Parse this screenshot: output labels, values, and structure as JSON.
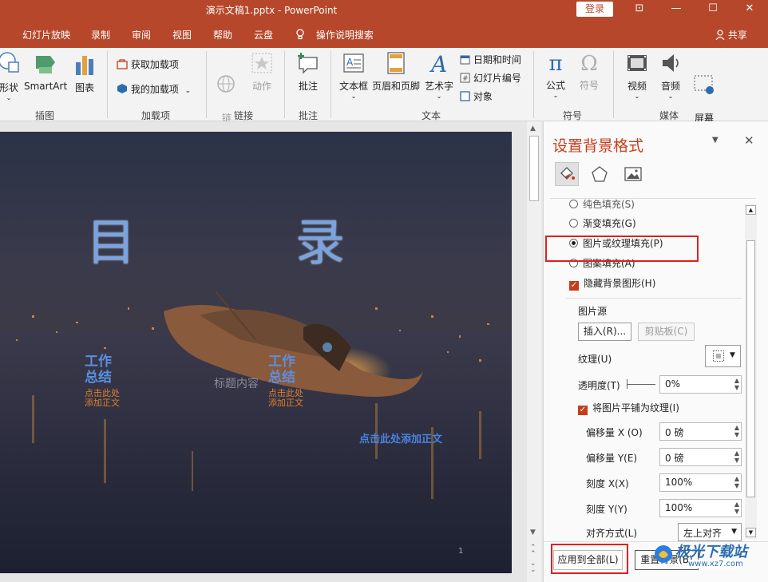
{
  "window": {
    "title": "演示文稿1.pptx  -  PowerPoint",
    "login": "登录",
    "controls": {
      "restore_ribbon": "⊡",
      "minimize": "—",
      "maximize": "☐",
      "close": "✕"
    }
  },
  "tabs": [
    "幻灯片放映",
    "录制",
    "审阅",
    "视图",
    "帮助",
    "云盘",
    "操作说明搜索"
  ],
  "share_label": "共享",
  "ribbon": {
    "shape_label": "形状",
    "smartart_label": "SmartArt",
    "chart_label": "图表",
    "get_addins_label": "获取加载项",
    "my_addins_label": "我的加载项",
    "link_label": "链\n接",
    "action_label": "动作",
    "comment_label": "批注",
    "textbox_label": "文本框",
    "header_footer_label": "页眉和页脚",
    "wordart_label": "艺术字",
    "datetime_label": "日期和时间",
    "slide_number_label": "幻灯片编号",
    "object_label": "对象",
    "equation_label": "公式",
    "symbol_label": "符号",
    "video_label": "视频",
    "audio_label": "音频",
    "screen_record_label": "屏幕\n录制",
    "groups": {
      "illustrations": "插图",
      "addins": "加载项",
      "links": "链接",
      "comments": "批注",
      "text": "文本",
      "symbols": "符号",
      "media": "媒体"
    }
  },
  "slide": {
    "title_left": "目",
    "title_right": "录",
    "item1_title": "工作\n总结",
    "item1_sub": "点击此处\n添加正文",
    "item2_title": "工作\n总结",
    "item2_sub": "点击此处\n添加正文",
    "center_hint": "标题内容",
    "click_text": "点击此处添加正文",
    "page_number": "1"
  },
  "panel": {
    "title": "设置背景格式",
    "options": {
      "solid_fill": "纯色填充(S)",
      "gradient_fill": "渐变填充(G)",
      "picture_texture_fill": "图片或纹理填充(P)",
      "pattern_fill": "图案填充(A)",
      "hide_background_graphics": "隐藏背景图形(H)"
    },
    "picture_source_label": "图片源",
    "insert_button": "插入(R)...",
    "clipboard_button": "剪贴板(C)",
    "texture_label": "纹理(U)",
    "transparency_label": "透明度(T)",
    "transparency_value": "0%",
    "tile_checkbox": "将图片平铺为纹理(I)",
    "offset_x_label": "偏移量 X (O)",
    "offset_x_value": "0 磅",
    "offset_y_label": "偏移量 Y(E)",
    "offset_y_value": "0 磅",
    "scale_x_label": "刻度 X(X)",
    "scale_x_value": "100%",
    "scale_y_label": "刻度 Y(Y)",
    "scale_y_value": "100%",
    "alignment_label": "对齐方式(L)",
    "alignment_value": "左上对齐",
    "apply_all_button": "应用到全部(L)",
    "reset_background_button": "重置背景(B)"
  },
  "watermark": {
    "brand": "极光下载站",
    "url": "www.xz7.com"
  },
  "colors": {
    "accent": "#b7472a",
    "panel_title": "#c43e1c",
    "highlight_box": "#e02020"
  }
}
